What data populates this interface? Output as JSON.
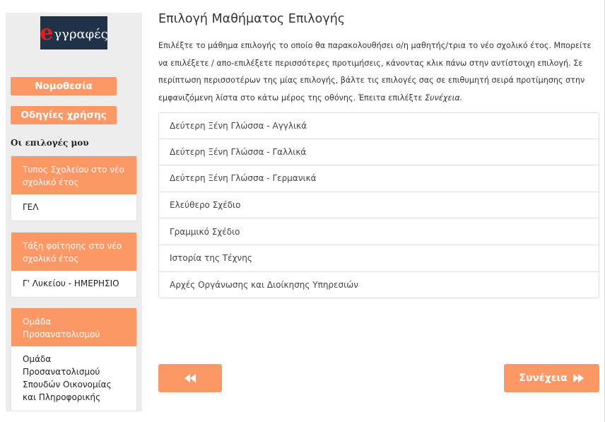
{
  "sidebar": {
    "logo": {
      "initial": "e",
      "rest": "γγραφές"
    },
    "buttons": {
      "legislation": "Νομοθεσία",
      "guide": "Οδηγίες χρήσης"
    },
    "my_choices_label": "Οι επιλογές μου",
    "cards": [
      {
        "header": "Τυπος Σχολείου στο νέο σχολικό έτος",
        "value": "ΓΕΛ"
      },
      {
        "header": "Τάξη φοίτησης στο νέο σχολικό έτος",
        "value": "Γ' Λυκείου - ΗΜΕΡΗΣΙΟ"
      },
      {
        "header": "Ομάδα Προσανατολισμού",
        "value": "Ομάδα Προσανατολισμού Σπουδών Οικονομίας και Πληροφορικής"
      }
    ]
  },
  "main": {
    "title": "Επιλογή Μαθήματος Επιλογής",
    "description": "Επιλέξτε το μάθημα επιλογής το οποίο θα παρακολουθήσει ο/η μαθητής/τρια το νέο σχολικό έτος. Μπορείτε να επιλέξετε / απο-επιλέξετε περισσότερες προτιμήσεις, κάνοντας κλικ πάνω στην αντίστοιχη επιλογή. Σε περίπτωση περισσοτέρων της μίας επιλογής, βάλτε τις επιλογές σας σε επιθυμητή σειρά προτίμησης στην εμφανιζόμενη λίστα στο κάτω μέρος της οθόνης. Έπειτα επιλέξτε ",
    "description_emphasis": "Συνέχεια.",
    "options": [
      "Δεύτερη Ξένη Γλώσσα - Αγγλικά",
      "Δεύτερη Ξένη Γλώσσα - Γαλλικά",
      "Δεύτερη Ξένη Γλώσσα - Γερμανικά",
      "Ελεύθερο Σχέδιο",
      "Γραμμικό Σχέδιο",
      "Ιστορία της Τέχνης",
      "Αρχές Οργάνωσης και Διοίκησης Υπηρεσιών"
    ],
    "next_label": "Συνέχεια"
  },
  "icons": {
    "back": "fast-backward-icon",
    "next": "fast-forward-icon"
  },
  "colors": {
    "accent": "#fc9866",
    "sidebar_bg": "#ededed",
    "logo_bg": "#1f3247",
    "logo_e": "#e02020"
  }
}
